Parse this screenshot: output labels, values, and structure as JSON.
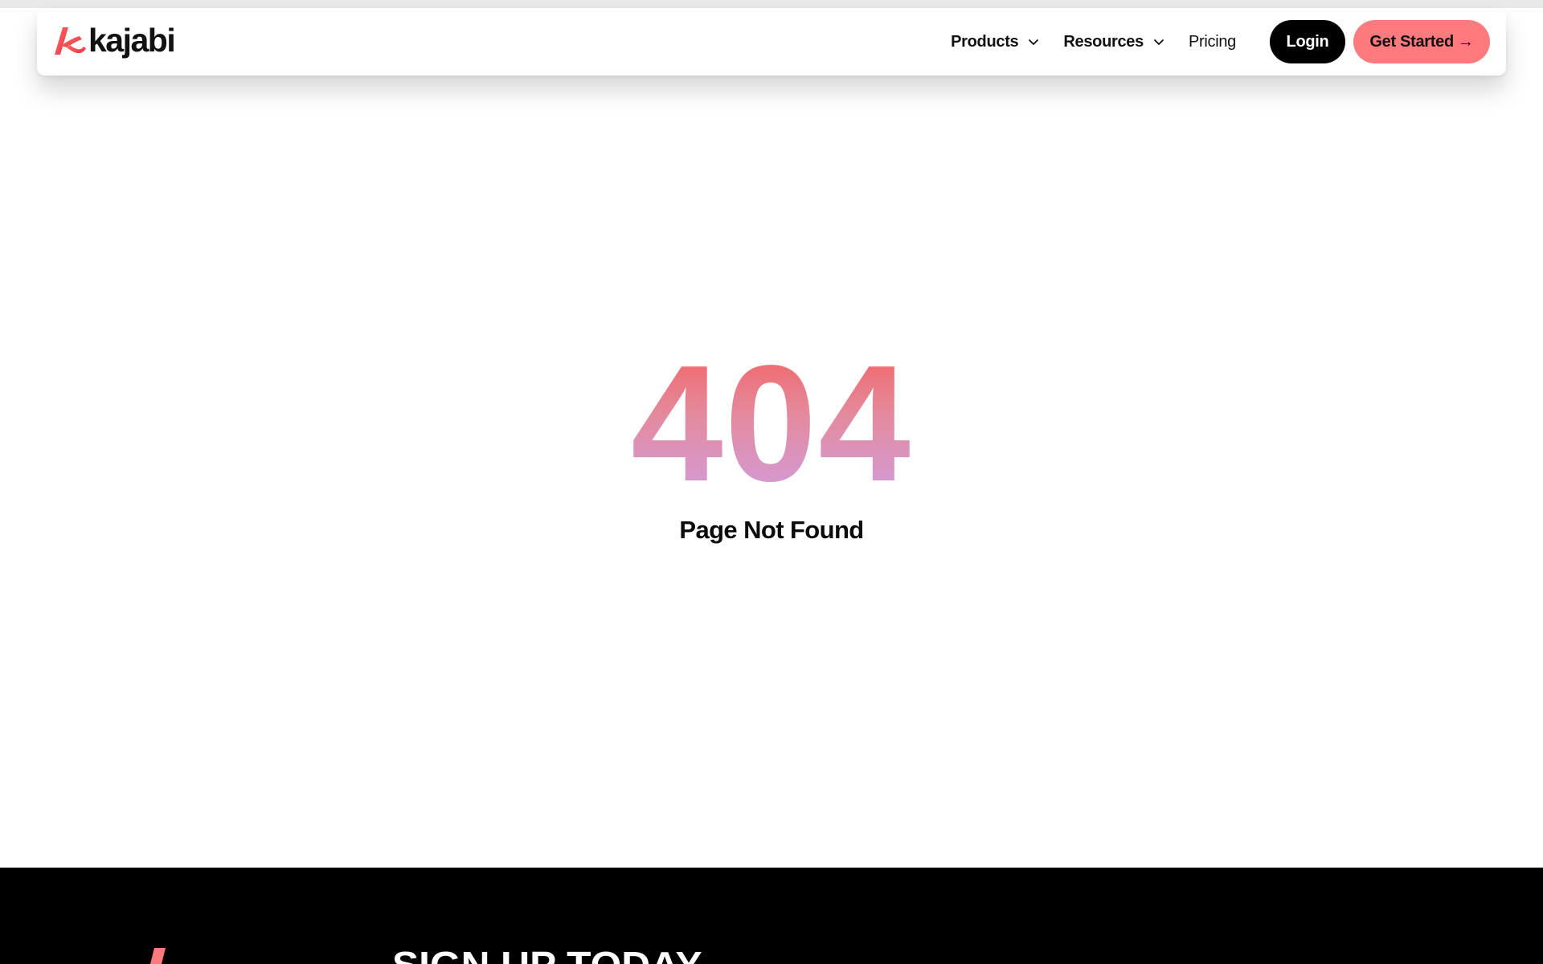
{
  "brand": {
    "name": "kajabi",
    "mark_icon": "kajabi-k-logo-icon",
    "accent_gradient": [
      "#f4605e",
      "#cf9ee0"
    ]
  },
  "nav": {
    "items": [
      {
        "label": "Products",
        "has_dropdown": true
      },
      {
        "label": "Resources",
        "has_dropdown": true
      },
      {
        "label": "Pricing",
        "has_dropdown": false
      }
    ],
    "login_label": "Login",
    "get_started_label": "Get Started",
    "get_started_icon": "arrow-right-icon"
  },
  "error": {
    "code": "404",
    "message": "Page Not Found"
  },
  "footer": {
    "headline": "SIGN UP TODAY"
  },
  "colors": {
    "login_bg": "#000000",
    "get_started_bg": "#ff7a7f",
    "footer_bg": "#000000"
  }
}
